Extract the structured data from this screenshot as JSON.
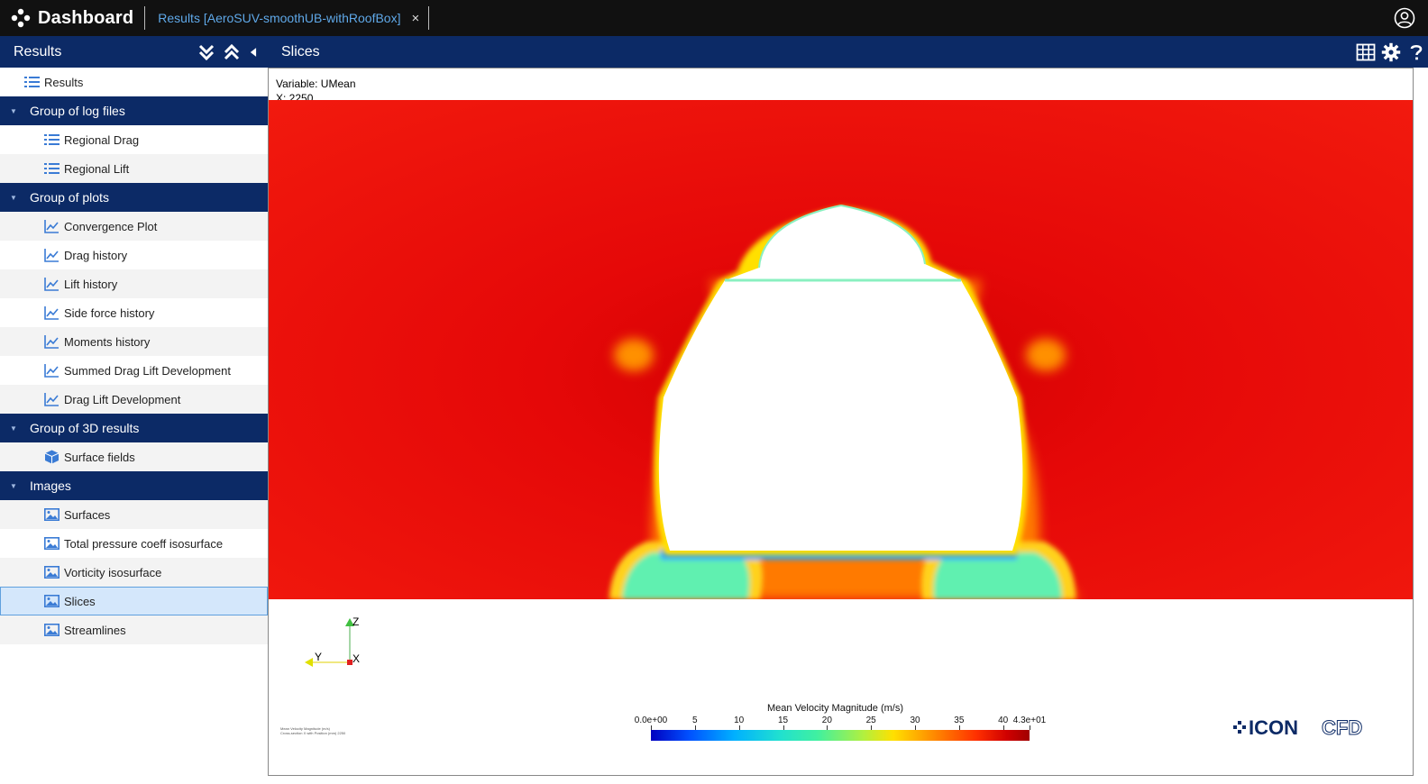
{
  "app": {
    "title": "Dashboard",
    "tab_label": "Results [AeroSUV-smoothUB-withRoofBox]",
    "tab_close": "×"
  },
  "left_panel": {
    "title": "Results",
    "root_label": "Results",
    "groups": [
      {
        "label": "Group of log files",
        "items": [
          "Regional Drag",
          "Regional Lift"
        ]
      },
      {
        "label": "Group of plots",
        "items": [
          "Convergence Plot",
          "Drag history",
          "Lift history",
          "Side force history",
          "Moments history",
          "Summed Drag Lift Development",
          "Drag Lift Development"
        ]
      },
      {
        "label": "Group of 3D results",
        "items": [
          "Surface fields"
        ]
      },
      {
        "label": "Images",
        "items": [
          "Surfaces",
          "Total pressure coeff isosurface",
          "Vorticity isosurface",
          "Slices",
          "Streamlines"
        ]
      }
    ],
    "selected_item": "Slices"
  },
  "right_panel": {
    "title": "Slices"
  },
  "viewer": {
    "variable_line": "Variable: UMean",
    "position_line": "X: 2250",
    "legend_title": "Mean Velocity Magnitude (m/s)",
    "legend_ticks": [
      "0.0e+00",
      "5",
      "10",
      "15",
      "20",
      "25",
      "30",
      "35",
      "40",
      "4.3e+01"
    ],
    "tiny_note_1": "Mean Velocity Magnitude (m/s)",
    "tiny_note_2": "Cross-section X with Position (mm) 2250",
    "axis_labels": {
      "z": "Z",
      "y": "Y",
      "x": "X"
    },
    "logo_text_1": "ICON",
    "logo_text_2": "CFD"
  },
  "colors": {
    "header_blue": "#0c2a66",
    "topbar": "#111111",
    "tab_link": "#5fa8e8",
    "selected_row": "#d4e7fb",
    "field_red": "#ee0d0d"
  }
}
